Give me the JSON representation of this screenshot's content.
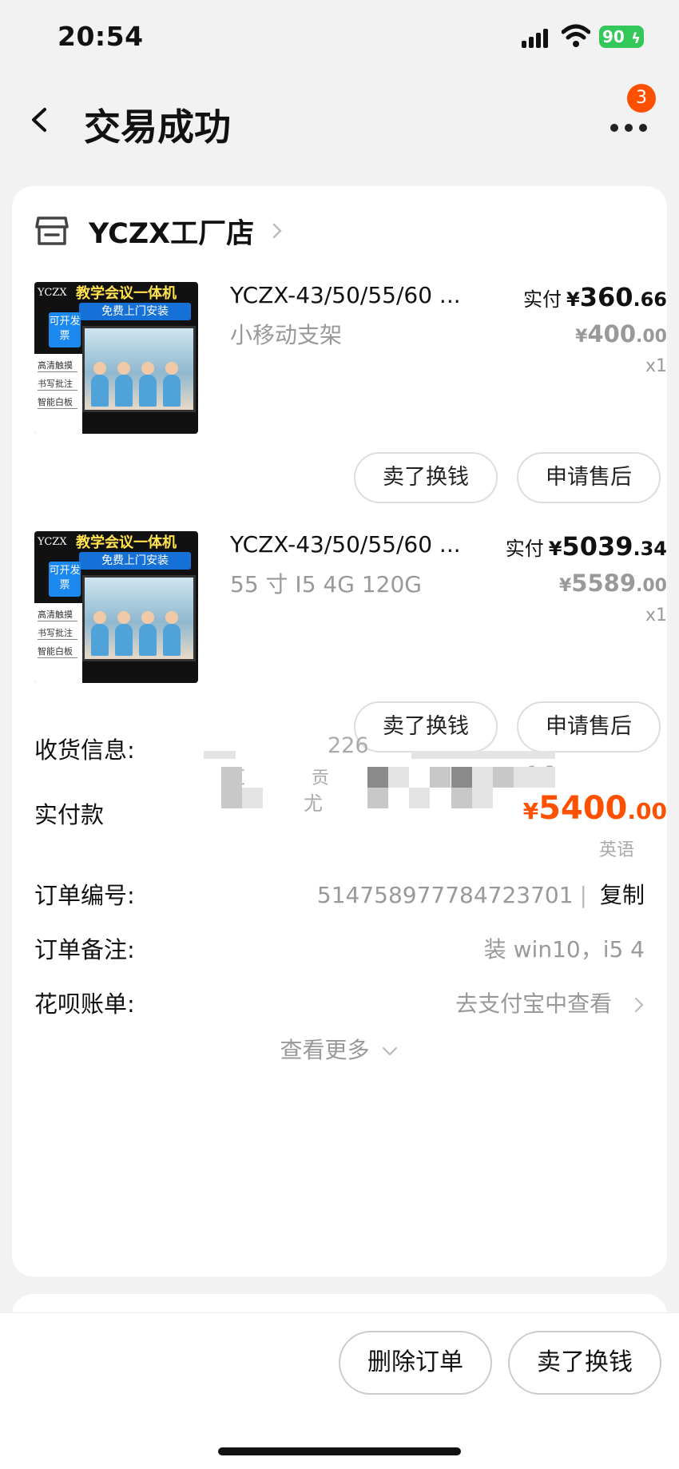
{
  "status_bar": {
    "time": "20:54",
    "battery": "90"
  },
  "header": {
    "title": "交易成功",
    "badge_count": "3"
  },
  "shop": {
    "name": "YCZX工厂店"
  },
  "products": [
    {
      "title": "YCZX-43/50/55/60 ...",
      "spec": "小移动支架",
      "paid_label": "实付",
      "paid_yen": "¥",
      "paid_int": "360",
      "paid_dec": ".66",
      "orig_yen": "¥",
      "orig_int": "400",
      "orig_dec": ".00",
      "qty": "x1",
      "thumb": {
        "logo": "YCZX",
        "banner": "教学会议一体机",
        "sub_banner": "免费上门安装",
        "tag": "可开发票",
        "features": [
          "高清触摸",
          "书写批注",
          "智能白板"
        ]
      },
      "btn_sell": "卖了换钱",
      "btn_aftersale": "申请售后"
    },
    {
      "title": "YCZX-43/50/55/60 ...",
      "spec": "55 寸 I5 4G 120G",
      "paid_label": "实付",
      "paid_yen": "¥",
      "paid_int": "5039",
      "paid_dec": ".34",
      "orig_yen": "¥",
      "orig_int": "5589",
      "orig_dec": ".00",
      "qty": "x1",
      "thumb": {
        "logo": "YCZX",
        "banner": "教学会议一体机",
        "sub_banner": "免费上门安装",
        "tag": "可开发票",
        "features": [
          "高清触摸",
          "书写批注",
          "智能白板"
        ]
      },
      "btn_sell": "卖了换钱",
      "btn_aftersale": "申请售后"
    }
  ],
  "total": {
    "label": "实付款",
    "yen": "¥",
    "int": "5400",
    "dec": ".00"
  },
  "shipping": {
    "label": "收货信息:",
    "fragments": [
      "226",
      "区",
      "贡",
      "1 8",
      "尤",
      "英语"
    ]
  },
  "order_no": {
    "label": "订单编号:",
    "value": "514758977784723701",
    "separator": "|",
    "copy": "复制"
  },
  "remark": {
    "label": "订单备注:",
    "value": "装 win10，i5 4"
  },
  "huabei": {
    "label": "花呗账单:",
    "value": "去支付宝中查看"
  },
  "see_more": "查看更多",
  "bottom": {
    "delete": "删除订单",
    "sell": "卖了换钱"
  },
  "colors": {
    "accent": "#ff5000",
    "battery": "#34c759"
  }
}
